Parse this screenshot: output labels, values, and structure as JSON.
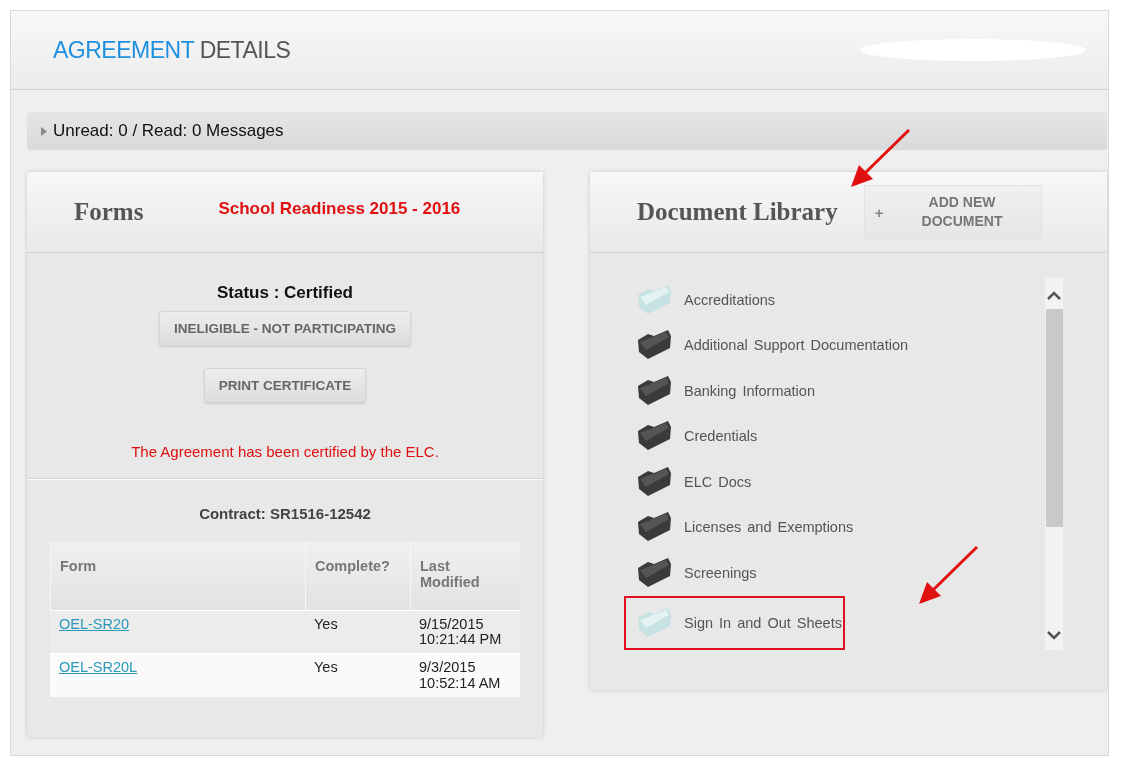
{
  "header": {
    "title_accent": "AGREEMENT",
    "title_rest": "DETAILS"
  },
  "messages": {
    "text": "Unread: 0 / Read: 0 Messages",
    "expanded": false
  },
  "forms_panel": {
    "title": "Forms",
    "program": "School Readiness 2015 - 2016",
    "status": "Status : Certified",
    "buttons": [
      "INELIGIBLE - NOT PARTICIPATING",
      "PRINT CERTIFICATE"
    ],
    "notice": "The Agreement has been certified by the ELC.",
    "contract": "Contract: SR1516-12542",
    "table": {
      "columns": [
        "Form",
        "Complete?",
        "Last Modified"
      ],
      "rows": [
        {
          "form": "OEL-SR20",
          "complete": "Yes",
          "modified": "9/15/2015 10:21:44 PM"
        },
        {
          "form": "OEL-SR20L",
          "complete": "Yes",
          "modified": "9/3/2015 10:52:14 AM"
        }
      ]
    }
  },
  "library_panel": {
    "title": "Document Library",
    "add_button": {
      "icon": "+",
      "label": "ADD NEW DOCUMENT"
    },
    "folders": [
      {
        "name": "Accreditations",
        "filled": false,
        "highlighted": false
      },
      {
        "name": "Additional Support Documentation",
        "filled": true,
        "highlighted": false
      },
      {
        "name": "Banking Information",
        "filled": true,
        "highlighted": false
      },
      {
        "name": "Credentials",
        "filled": true,
        "highlighted": false
      },
      {
        "name": "ELC Docs",
        "filled": true,
        "highlighted": false
      },
      {
        "name": "Licenses and Exemptions",
        "filled": true,
        "highlighted": false
      },
      {
        "name": "Screenings",
        "filled": true,
        "highlighted": false
      },
      {
        "name": "Sign In and Out Sheets",
        "filled": false,
        "highlighted": true
      }
    ]
  }
}
